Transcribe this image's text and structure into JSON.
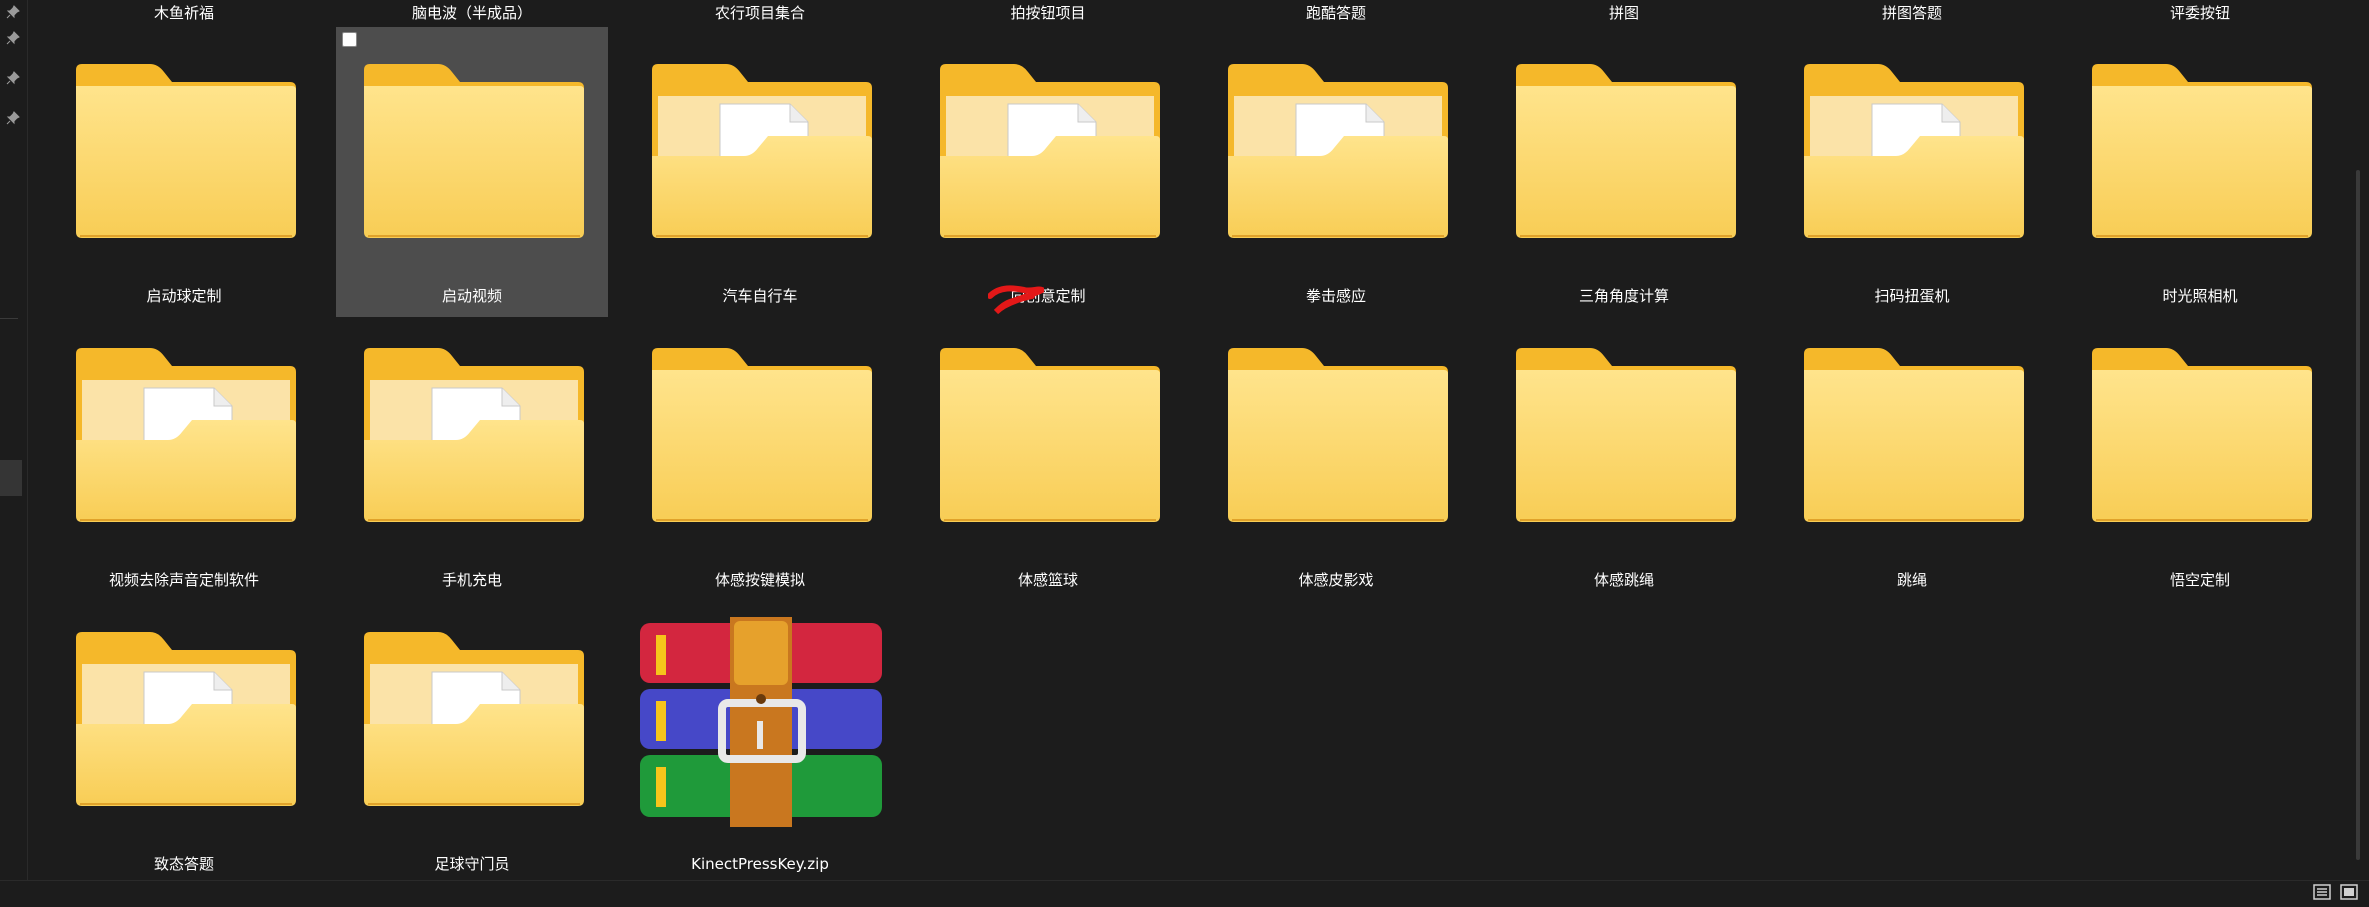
{
  "top_row_labels": [
    "木鱼祈福",
    "脑电波（半成品）",
    "农行项目集合",
    "拍按钮项目",
    "跑酷答题",
    "拼图",
    "拼图答题",
    "评委按钮"
  ],
  "rows": [
    {
      "items": [
        {
          "label": "启动球定制",
          "type": "folder",
          "has_doc": false
        },
        {
          "label": "启动视频",
          "type": "folder",
          "has_doc": false,
          "selected": true
        },
        {
          "label": "汽车自行车",
          "type": "folder",
          "has_doc": true
        },
        {
          "label": "向创意定制",
          "type": "folder",
          "has_doc": true
        },
        {
          "label": "拳击感应",
          "type": "folder",
          "has_doc": true
        },
        {
          "label": "三角角度计算",
          "type": "folder",
          "has_doc": false
        },
        {
          "label": "扫码扭蛋机",
          "type": "folder",
          "has_doc": true
        },
        {
          "label": "时光照相机",
          "type": "folder",
          "has_doc": false
        }
      ]
    },
    {
      "items": [
        {
          "label": "视频去除声音定制软件",
          "type": "folder",
          "has_doc": true
        },
        {
          "label": "手机充电",
          "type": "folder",
          "has_doc": true
        },
        {
          "label": "体感按键模拟",
          "type": "folder",
          "has_doc": false
        },
        {
          "label": "体感篮球",
          "type": "folder",
          "has_doc": false
        },
        {
          "label": "体感皮影戏",
          "type": "folder",
          "has_doc": false
        },
        {
          "label": "体感跳绳",
          "type": "folder",
          "has_doc": false
        },
        {
          "label": "跳绳",
          "type": "folder",
          "has_doc": false
        },
        {
          "label": "悟空定制",
          "type": "folder",
          "has_doc": false
        }
      ]
    },
    {
      "items": [
        {
          "label": "致态答题",
          "type": "folder",
          "has_doc": true
        },
        {
          "label": "足球守门员",
          "type": "folder",
          "has_doc": true
        },
        {
          "label": "KinectPressKey.zip",
          "type": "zip"
        }
      ]
    }
  ],
  "colors": {
    "background": "#1c1c1c",
    "selected_tile": "#4d4d4d",
    "folder_back": "#f5b82a",
    "folder_front": "#fcd874",
    "redaction": "#e31818"
  },
  "icons": [
    "pin-icon",
    "folder-icon",
    "document-icon",
    "winrar-archive-icon",
    "details-view-icon",
    "tiles-view-icon"
  ]
}
